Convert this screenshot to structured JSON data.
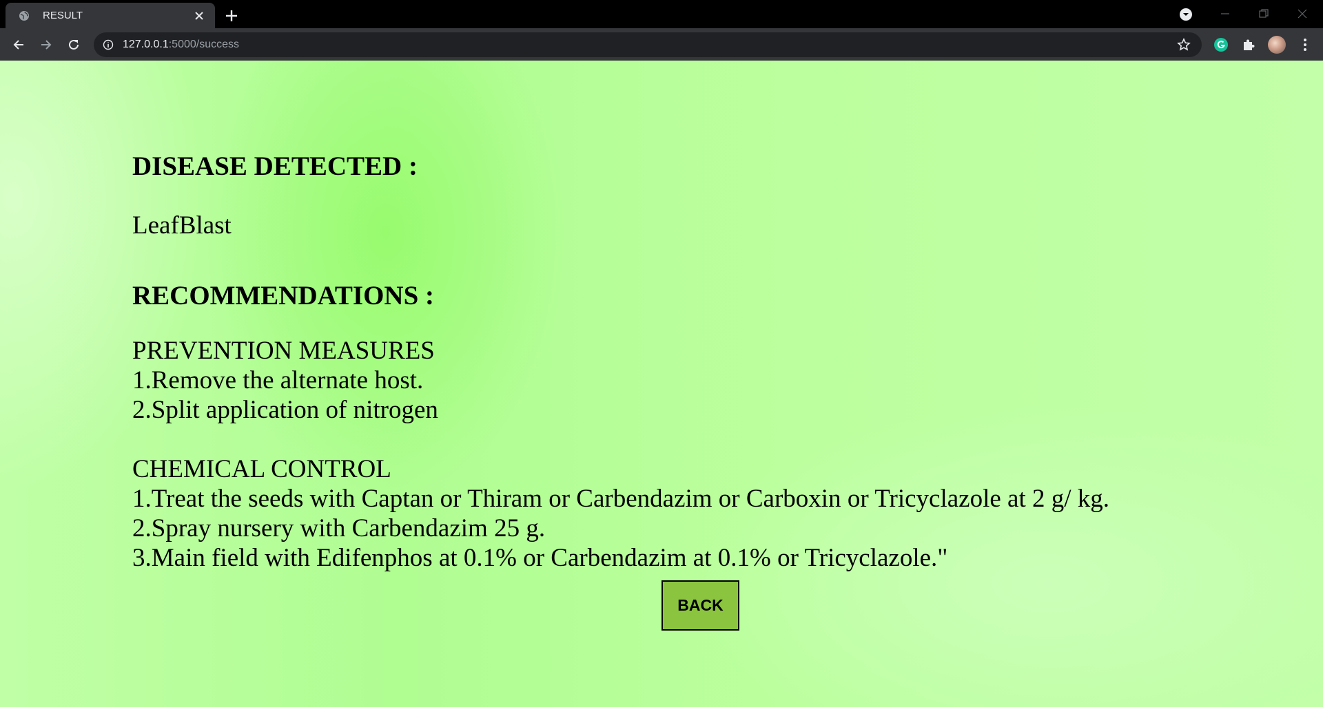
{
  "browser": {
    "tab_title": "RESULT",
    "url_host": "127.0.0.1",
    "url_path": ":5000/success"
  },
  "page": {
    "disease_heading": "DISEASE DETECTED :",
    "disease_name": "LeafBlast",
    "recommendations_heading": "RECOMMENDATIONS :",
    "prevention": {
      "title": "PREVENTION MEASURES",
      "items": [
        "1.Remove the alternate host.",
        "2.Split application of nitrogen"
      ]
    },
    "chemical": {
      "title": "CHEMICAL CONTROL",
      "items": [
        "1.Treat the seeds with Captan or Thiram or Carbendazim or Carboxin or Tricyclazole at 2 g/ kg.",
        "2.Spray nursery with Carbendazim 25 g.",
        "3.Main field with Edifenphos at 0.1% or Carbendazim at 0.1% or Tricyclazole.\""
      ]
    },
    "back_label": "BACK"
  },
  "icons": {
    "favicon": "globe-icon",
    "tab_close": "close-icon",
    "new_tab": "plus-icon",
    "tab_search": "chevron-down-circle-icon",
    "back": "arrow-left-icon",
    "forward": "arrow-right-icon",
    "reload": "reload-icon",
    "site_info": "info-icon",
    "bookmark": "star-icon",
    "grammarly": "grammarly-icon",
    "extensions": "puzzle-icon",
    "menu": "kebab-icon"
  },
  "colors": {
    "back_button": "#8bc53f",
    "page_background": "#b0fd92",
    "grammarly": "#15c39a"
  }
}
